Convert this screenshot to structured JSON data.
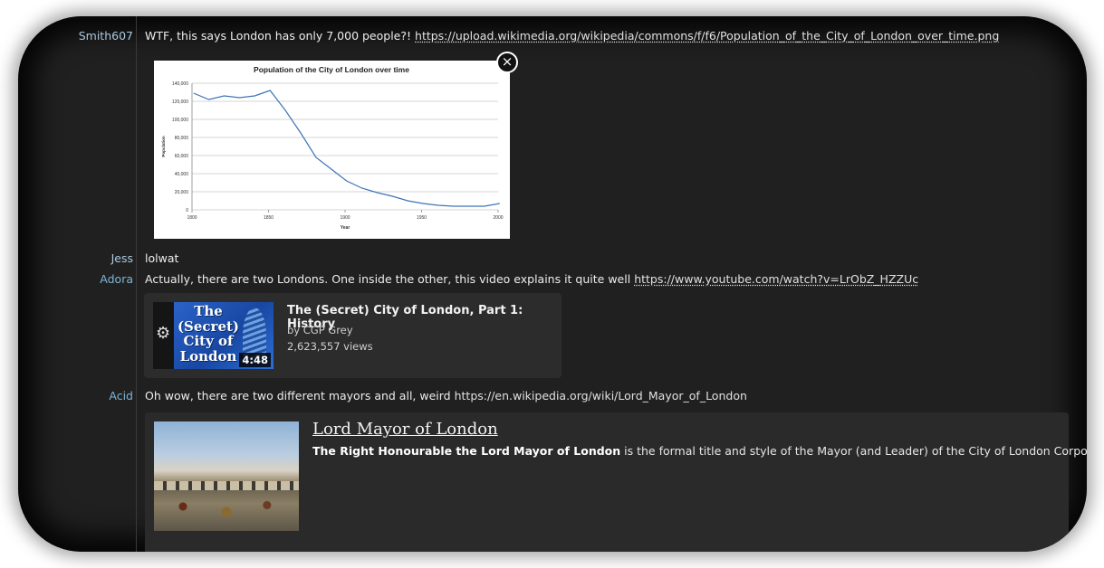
{
  "messages": [
    {
      "nick": "Smith607",
      "text": "WTF, this says London has only 7,000 people?!",
      "link": "https://upload.wikimedia.org/wikipedia/commons/f/f6/Population_of_the_City_of_London_over_time.png"
    },
    {
      "nick": "Jess",
      "text": "lolwat"
    },
    {
      "nick": "Adora",
      "text": "Actually, there are two Londons. One inside the other, this video explains it quite well",
      "link": "https://www.youtube.com/watch?v=LrObZ_HZZUc"
    },
    {
      "nick": "Acid",
      "text": "Oh wow, there are two different mayors and all, weird",
      "link": "https://en.wikipedia.org/wiki/Lord_Mayor_of_London"
    }
  ],
  "close_glyph": "×",
  "chart_data": {
    "type": "line",
    "title": "Population of the City of London over time",
    "xlabel": "Year",
    "ylabel": "Population",
    "xlim": [
      1800,
      2000
    ],
    "ylim": [
      0,
      140000
    ],
    "x_ticks": [
      "1800",
      "1850",
      "1900",
      "1950",
      "2000"
    ],
    "y_ticks": [
      "0",
      "20,000",
      "40,000",
      "60,000",
      "80,000",
      "100,000",
      "120,000",
      "140,000"
    ],
    "grid": true,
    "x": [
      1801,
      1811,
      1821,
      1831,
      1841,
      1851,
      1861,
      1871,
      1881,
      1891,
      1901,
      1911,
      1921,
      1931,
      1941,
      1951,
      1961,
      1971,
      1981,
      1991,
      2001
    ],
    "y": [
      129000,
      122000,
      126000,
      124000,
      126000,
      132000,
      110000,
      85000,
      58000,
      45000,
      32000,
      24000,
      19000,
      15000,
      10000,
      7000,
      5000,
      4000,
      4000,
      4000,
      7000
    ],
    "line_color": "#3d74b6"
  },
  "youtube": {
    "title": "The (Secret) City of London, Part 1: History",
    "author": "by CGP Grey",
    "views": "2,623,557 views",
    "duration": "4:48",
    "thumb_text": [
      "The",
      "(Secret)",
      "City of",
      "London"
    ]
  },
  "wiki": {
    "title": "Lord Mayor of London",
    "extract_bold": "The Right Honourable the Lord Mayor of London",
    "extract_rest": " is the formal title and style of the Mayor (and Leader) of the City of London Corporation."
  }
}
